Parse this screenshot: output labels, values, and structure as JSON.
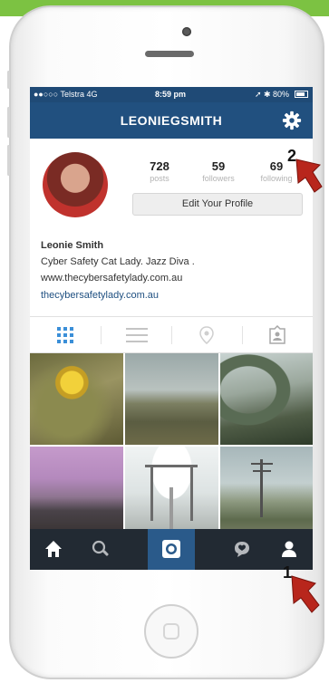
{
  "status_bar": {
    "carrier": "●●○○○ Telstra 4G",
    "time": "8:59 pm",
    "battery": "80%"
  },
  "nav": {
    "username": "LEONIEGSMITH"
  },
  "profile": {
    "posts_count": "728",
    "posts_label": "posts",
    "followers_count": "59",
    "followers_label": "followers",
    "following_count": "69",
    "following_label": "following",
    "edit_button": "Edit Your Profile",
    "name": "Leonie Smith",
    "bio_line1": "Cyber Safety Cat Lady. Jazz Diva .",
    "bio_line2": "www.thecybersafetylady.com.au",
    "website": "thecybersafetylady.com.au"
  },
  "tabs": [
    "grid-view",
    "list-view",
    "location-view",
    "tagged-view"
  ],
  "bottom_nav": [
    "home",
    "search",
    "camera",
    "activity",
    "profile"
  ],
  "annotations": {
    "badge_1": "1",
    "badge_2": "2"
  },
  "colors": {
    "nav": "#21507f",
    "status": "#1f4a76",
    "bottom_bar": "#222a33",
    "active_tab": "#2a5a8a",
    "arrow": "#b8261c"
  }
}
